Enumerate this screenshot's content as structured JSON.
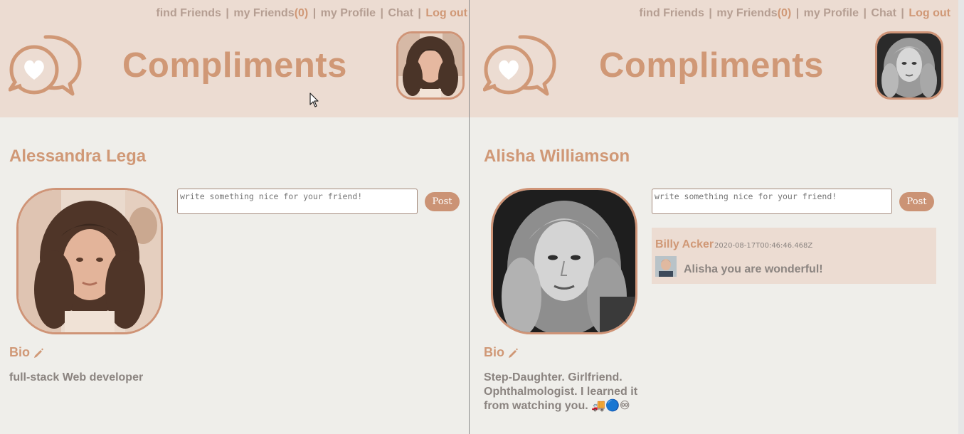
{
  "nav": {
    "find_friends": "find Friends",
    "my_friends": "my Friends",
    "friend_count": "(0)",
    "my_profile": "my Profile",
    "chat": "Chat",
    "log_out": "Log out",
    "separator": "|"
  },
  "brand": {
    "title": "Compliments",
    "logo_icon": "chat-bubbles-heart-icon"
  },
  "left": {
    "user_name": "Alessandra Lega",
    "bio_label": "Bio",
    "bio_text": "full-stack Web developer",
    "input_placeholder": "write something nice for your friend!",
    "post_label": "Post"
  },
  "right": {
    "user_name": "Alisha Williamson",
    "bio_label": "Bio",
    "bio_text": "Step-Daughter. Girlfriend. Ophthalmologist. I learned it from watching you. 🚚🔵♾",
    "input_placeholder": "write something nice for your friend!",
    "post_label": "Post",
    "compliments": [
      {
        "author": "Billy Acker",
        "timestamp": "2020-08-17T00:46:46.468Z",
        "text": "Alisha you are wonderful!"
      }
    ]
  },
  "colors": {
    "accent": "#d09876",
    "header_bg": "#ecdcd2",
    "page_bg": "#efeeea",
    "text_muted": "#8b8480",
    "nav_text": "#b59e92"
  }
}
